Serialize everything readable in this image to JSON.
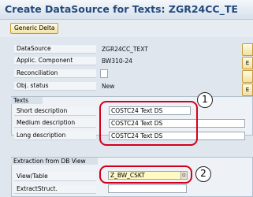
{
  "window": {
    "title": "Create DataSource for Texts: ZGR24CC_TE"
  },
  "toolbar": {
    "generic_delta_label": "Generic Delta"
  },
  "header_fields": [
    {
      "label": "DataSource",
      "value": "ZGR24CC_TEXT"
    },
    {
      "label": "Applic. Component",
      "value": "BW310-24"
    },
    {
      "label": "Reconciliation",
      "value": ""
    },
    {
      "label": "Obj. status",
      "value": "New"
    }
  ],
  "texts_group": {
    "title": "Texts",
    "fields": [
      {
        "label": "Short description",
        "value": "COSTC24 Text DS"
      },
      {
        "label": "Medium description",
        "value": "COSTC24 Text DS"
      },
      {
        "label": "Long description",
        "value": "COSTC24 Text DS"
      }
    ]
  },
  "extraction_group": {
    "title": "Extraction from DB View",
    "fields": [
      {
        "label": "View/Table",
        "value": "Z_BW_CSKT"
      },
      {
        "label": "ExtractStruct.",
        "value": ""
      }
    ]
  },
  "callouts": [
    "1",
    "2"
  ],
  "right_buttons": [
    "",
    "E",
    "",
    "E"
  ]
}
